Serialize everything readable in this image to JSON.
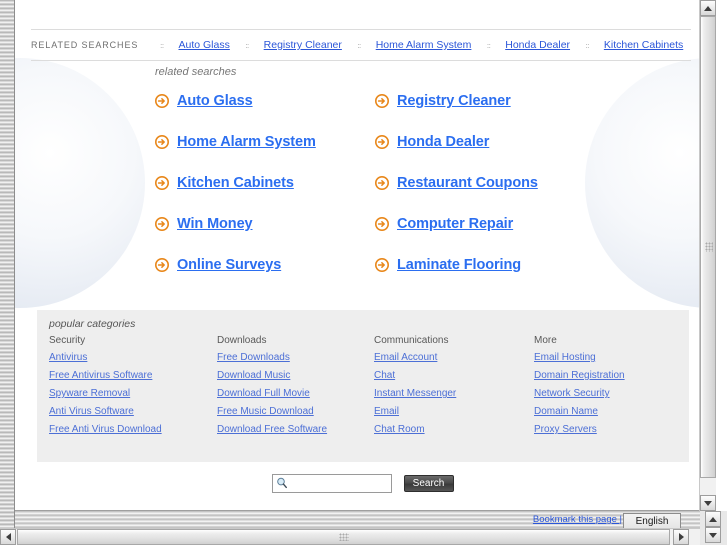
{
  "topbar": {
    "label": "RELATED SEARCHES",
    "separator": "::",
    "links": [
      "Auto Glass",
      "Registry Cleaner",
      "Home Alarm System",
      "Honda Dealer",
      "Kitchen Cabinets"
    ]
  },
  "related_searches": {
    "title": "related searches",
    "items": [
      "Auto Glass",
      "Registry Cleaner",
      "Home Alarm System",
      "Honda Dealer",
      "Kitchen Cabinets",
      "Restaurant Coupons",
      "Win Money",
      "Computer Repair",
      "Online Surveys",
      "Laminate Flooring"
    ]
  },
  "popular_categories": {
    "title": "popular categories",
    "columns": [
      {
        "heading": "Security",
        "links": [
          "Antivirus",
          "Free Antivirus Software",
          "Spyware Removal",
          "Anti Virus Software",
          "Free Anti Virus Download"
        ]
      },
      {
        "heading": "Downloads",
        "links": [
          "Free Downloads",
          "Download Music",
          "Download Full Movie",
          "Free Music Download",
          "Download Free Software"
        ]
      },
      {
        "heading": "Communications",
        "links": [
          "Email Account",
          "Chat",
          "Instant Messenger",
          "Email",
          "Chat Room"
        ]
      },
      {
        "heading": "More",
        "links": [
          "Email Hosting",
          "Domain Registration",
          "Network Security",
          "Domain Name",
          "Proxy Servers"
        ]
      }
    ]
  },
  "search": {
    "value": "",
    "placeholder": "",
    "button_label": "Search",
    "icon": "magnifier-icon"
  },
  "statusbar": {
    "bookmark_label": "Bookmark this page |",
    "language": "English"
  },
  "icons": {
    "list_arrow": "circle-arrow-right-icon",
    "scroll_up": "triangle-up-icon",
    "scroll_down": "triangle-down-icon",
    "scroll_left": "triangle-left-icon",
    "scroll_right": "triangle-right-icon",
    "dropdown": "chevron-down-icon"
  },
  "colors": {
    "link": "#2b6ef0",
    "small_link": "#4c6fd6",
    "arrow_orange": "#e8871a",
    "panel_bg": "#eeeeee"
  }
}
